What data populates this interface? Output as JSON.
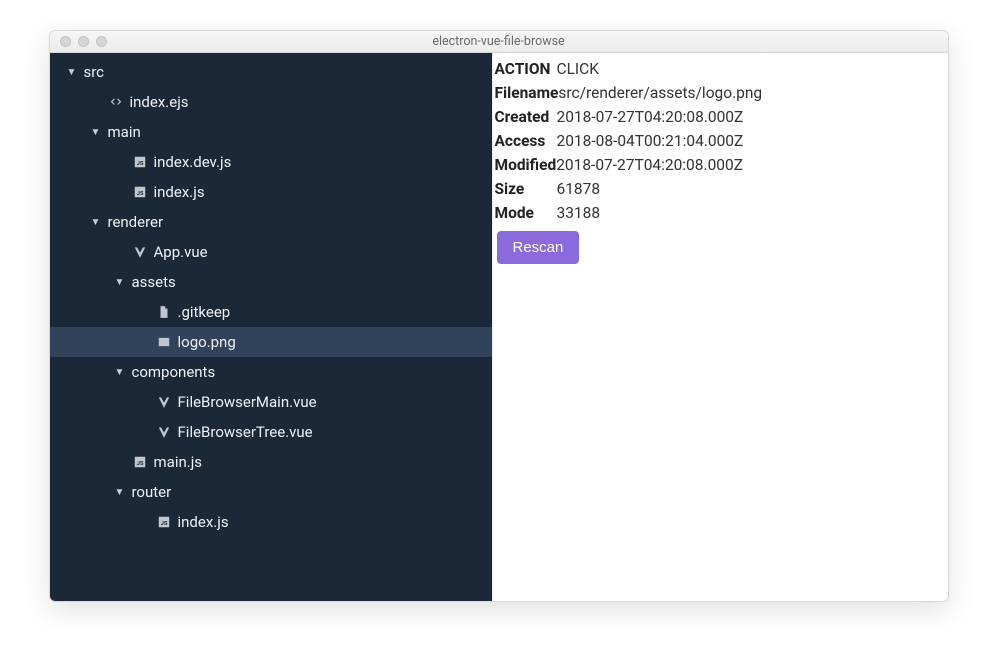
{
  "window": {
    "title": "electron-vue-file-browse"
  },
  "tree": [
    {
      "depth": 0,
      "expanded": true,
      "icon": "folder",
      "label": "src"
    },
    {
      "depth": 1,
      "expanded": null,
      "icon": "code",
      "label": "index.ejs"
    },
    {
      "depth": 1,
      "expanded": true,
      "icon": "folder",
      "label": "main"
    },
    {
      "depth": 2,
      "expanded": null,
      "icon": "js",
      "label": "index.dev.js"
    },
    {
      "depth": 2,
      "expanded": null,
      "icon": "js",
      "label": "index.js"
    },
    {
      "depth": 1,
      "expanded": true,
      "icon": "folder",
      "label": "renderer"
    },
    {
      "depth": 2,
      "expanded": null,
      "icon": "vue",
      "label": "App.vue"
    },
    {
      "depth": 2,
      "expanded": true,
      "icon": "folder",
      "label": "assets"
    },
    {
      "depth": 3,
      "expanded": null,
      "icon": "file",
      "label": ".gitkeep"
    },
    {
      "depth": 3,
      "expanded": null,
      "icon": "image",
      "label": "logo.png",
      "selected": true
    },
    {
      "depth": 2,
      "expanded": true,
      "icon": "folder",
      "label": "components"
    },
    {
      "depth": 3,
      "expanded": null,
      "icon": "vue",
      "label": "FileBrowserMain.vue"
    },
    {
      "depth": 3,
      "expanded": null,
      "icon": "vue",
      "label": "FileBrowserTree.vue"
    },
    {
      "depth": 2,
      "expanded": null,
      "icon": "js",
      "label": "main.js"
    },
    {
      "depth": 2,
      "expanded": true,
      "icon": "folder",
      "label": "router"
    },
    {
      "depth": 3,
      "expanded": null,
      "icon": "js",
      "label": "index.js"
    }
  ],
  "details": {
    "rows": [
      {
        "key": "ACTION",
        "val": "CLICK"
      },
      {
        "key": "Filename",
        "val": "src/renderer/assets/logo.png"
      },
      {
        "key": "Created",
        "val": "2018-07-27T04:20:08.000Z"
      },
      {
        "key": "Access",
        "val": "2018-08-04T00:21:04.000Z"
      },
      {
        "key": "Modified",
        "val": "2018-07-27T04:20:08.000Z"
      },
      {
        "key": "Size",
        "val": "61878"
      },
      {
        "key": "Mode",
        "val": "33188"
      }
    ],
    "rescan_label": "Rescan"
  }
}
